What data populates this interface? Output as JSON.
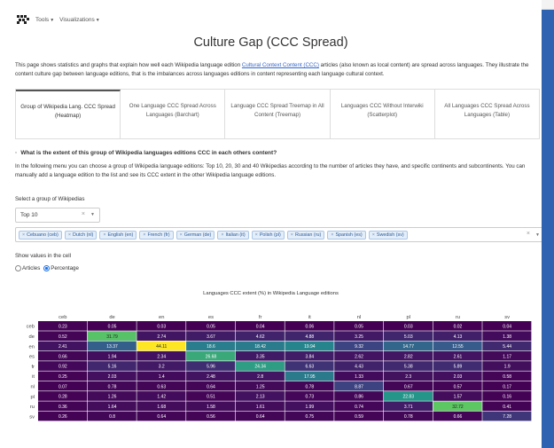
{
  "nav": {
    "tools": "Tools",
    "visualizations": "Visualizations"
  },
  "page_title": "Culture Gap (CCC Spread)",
  "intro": {
    "part1": "This page shows statistics and graphs that explain how well each Wikipedia language edition ",
    "link": "Cultural Context Content (CCC)",
    "part2": " articles (also known as local content) are spread across languages. They illustrate the content culture gap between language editions, that is the imbalances across languages editions in content representing each language cultural context."
  },
  "tabs": [
    "Group of Wikipedia Lang. CCC Spread (Heatmap)",
    "One Language CCC Spread Across Languages (Barchart)",
    "Language CCC Spread Treemap in All Content (Treemap)",
    "Languages CCC Without Interwiki (Scatterplot)",
    "All Languages CCC Spread Across Languages (Table)"
  ],
  "question": "What is the extent of this group of Wikipedia languages editions CCC in each others content?",
  "description": "In the following menu you can choose a group of Wikipedia language editions: Top 10, 20, 30 and 40 Wikipedias according to the number of articles they have, and specific continents and subcontinents. You can manually add a language edition to the list and see its CCC extent in the other Wikipedia language editions.",
  "select_label": "Select a group of Wikipedias",
  "group_select": {
    "value": "Top 10"
  },
  "languages": [
    "Cebuano (ceb)",
    "Dutch (nl)",
    "English (en)",
    "French (fr)",
    "German (de)",
    "Italian (it)",
    "Polish (pl)",
    "Russian (ru)",
    "Spanish (es)",
    "Swedish (sv)"
  ],
  "show_label": "Show values in the cell",
  "radio_articles": "Articles",
  "radio_percentage": "Percentage",
  "chart_data": {
    "type": "heatmap",
    "title": "Languages CCC extent (%) in Wikipedia Language editions",
    "x": [
      "ceb",
      "de",
      "en",
      "es",
      "fr",
      "it",
      "nl",
      "pl",
      "ru",
      "sv"
    ],
    "y": [
      "ceb",
      "de",
      "en",
      "es",
      "fr",
      "it",
      "nl",
      "pl",
      "ru",
      "sv"
    ],
    "values": [
      [
        0.23,
        0.05,
        0.03,
        0.05,
        0.04,
        0.06,
        0.05,
        0.03,
        0.02,
        0.04
      ],
      [
        0.52,
        31.79,
        2.74,
        3.67,
        4.62,
        4.88,
        3.25,
        5.03,
        4.13,
        1.38
      ],
      [
        2.41,
        13.37,
        44.11,
        18.6,
        18.42,
        19.94,
        9.32,
        14.77,
        12.55,
        5.44
      ],
      [
        0.66,
        1.94,
        2.34,
        26.68,
        3.35,
        3.84,
        2.62,
        2.82,
        2.61,
        1.17
      ],
      [
        0.92,
        5.16,
        3.2,
        5.96,
        24.34,
        6.63,
        4.43,
        5.38,
        5.89,
        1.9
      ],
      [
        0.25,
        2.03,
        1.4,
        2.48,
        2.8,
        17.95,
        1.33,
        2.3,
        2.03,
        0.58
      ],
      [
        0.07,
        0.78,
        0.63,
        0.64,
        1.25,
        0.78,
        8.87,
        0.67,
        0.57,
        0.17
      ],
      [
        0.28,
        1.26,
        1.42,
        0.51,
        2.13,
        0.73,
        0.86,
        22.83,
        1.57,
        0.16
      ],
      [
        0.36,
        1.64,
        1.68,
        1.58,
        1.61,
        1.99,
        0.74,
        3.71,
        32.72,
        0.41
      ],
      [
        0.26,
        0.8,
        0.64,
        0.56,
        0.64,
        0.75,
        0.59,
        0.78,
        0.66,
        7.28
      ]
    ],
    "colorscale": [
      "#440154",
      "#3b528b",
      "#21918c",
      "#5ec962",
      "#fde725"
    ],
    "zmin": 0,
    "zmax": 44.11
  }
}
